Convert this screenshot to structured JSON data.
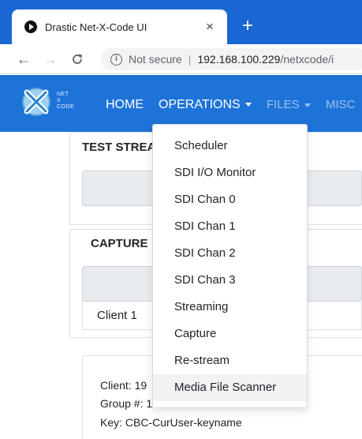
{
  "browser": {
    "tab_title": "Drastic Net-X-Code UI",
    "tab_close": "×",
    "new_tab": "+",
    "back": "←",
    "forward": "→",
    "reload": "C",
    "info_glyph": "i",
    "security_label": "Not secure",
    "separator": "|",
    "url_host": "192.168.100.229",
    "url_path": "/netxcode/i",
    "colors": {
      "tabstrip": "#1967d2",
      "toolbar": "#ffffff"
    }
  },
  "app_nav": {
    "logo_lines": [
      "NET",
      "X",
      "CODE"
    ],
    "items": [
      {
        "label": "HOME",
        "has_caret": false
      },
      {
        "label": "OPERATIONS",
        "has_caret": true
      },
      {
        "label": "FILES",
        "has_caret": true
      },
      {
        "label": "MISC",
        "has_caret": false
      }
    ],
    "color": "#1e73d8"
  },
  "panels": {
    "test_stream_title": "TEST STREA",
    "capture_title": "CAPTURE",
    "client_row": "Client 1",
    "info_lines": [
      "Client: 19",
      "Group #: 1",
      "Key: CBC-CurUser-keyname"
    ]
  },
  "dropdown": {
    "items": [
      "Scheduler",
      "SDI I/O Monitor",
      "SDI Chan 0",
      "SDI Chan 1",
      "SDI Chan 2",
      "SDI Chan 3",
      "Streaming",
      "Capture",
      "Re-stream",
      "Media File Scanner"
    ],
    "hovered": "Media File Scanner"
  }
}
